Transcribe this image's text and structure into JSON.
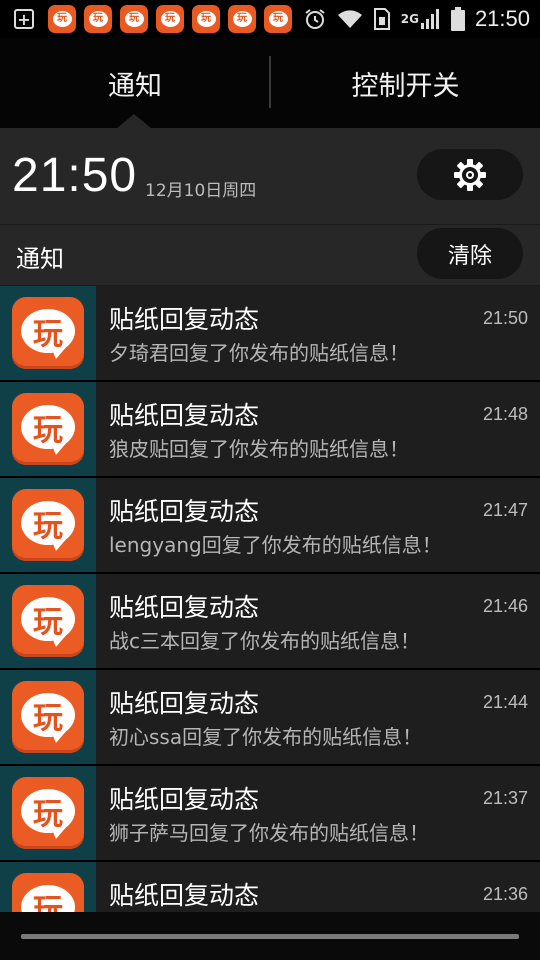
{
  "status_bar": {
    "time": "21:50",
    "network": "2G",
    "app_icon_glyph": "玩",
    "app_icon_count": 7,
    "icons": [
      "add-box-icon",
      "app-notification-icon",
      "alarm-icon",
      "wifi-icon",
      "sim-icon",
      "signal-icon",
      "battery-icon"
    ]
  },
  "tabs": {
    "notifications": "通知",
    "toggles": "控制开关"
  },
  "header": {
    "time": "21:50",
    "date": "12月10日周四",
    "settings_icon": "gear-icon"
  },
  "notification_section": {
    "title": "通知",
    "clear_label": "清除"
  },
  "notifications": [
    {
      "title": "贴纸回复动态",
      "message": "夕琦君回复了你发布的贴纸信息！",
      "time": "21:50"
    },
    {
      "title": "贴纸回复动态",
      "message": "狼皮贴回复了你发布的贴纸信息！",
      "time": "21:48"
    },
    {
      "title": "贴纸回复动态",
      "message": "lengyang回复了你发布的贴纸信息！",
      "time": "21:47"
    },
    {
      "title": "贴纸回复动态",
      "message": "战c三本回复了你发布的贴纸信息！",
      "time": "21:46"
    },
    {
      "title": "贴纸回复动态",
      "message": "初心ssa回复了你发布的贴纸信息！",
      "time": "21:44"
    },
    {
      "title": "贴纸回复动态",
      "message": "狮子萨马回复了你发布的贴纸信息！",
      "time": "21:37"
    },
    {
      "title": "贴纸回复动态",
      "message": "",
      "time": "21:36"
    }
  ],
  "colors": {
    "app_orange": "#ea5c23",
    "icon_cell": "#0f3f47",
    "panel": "#272727"
  }
}
